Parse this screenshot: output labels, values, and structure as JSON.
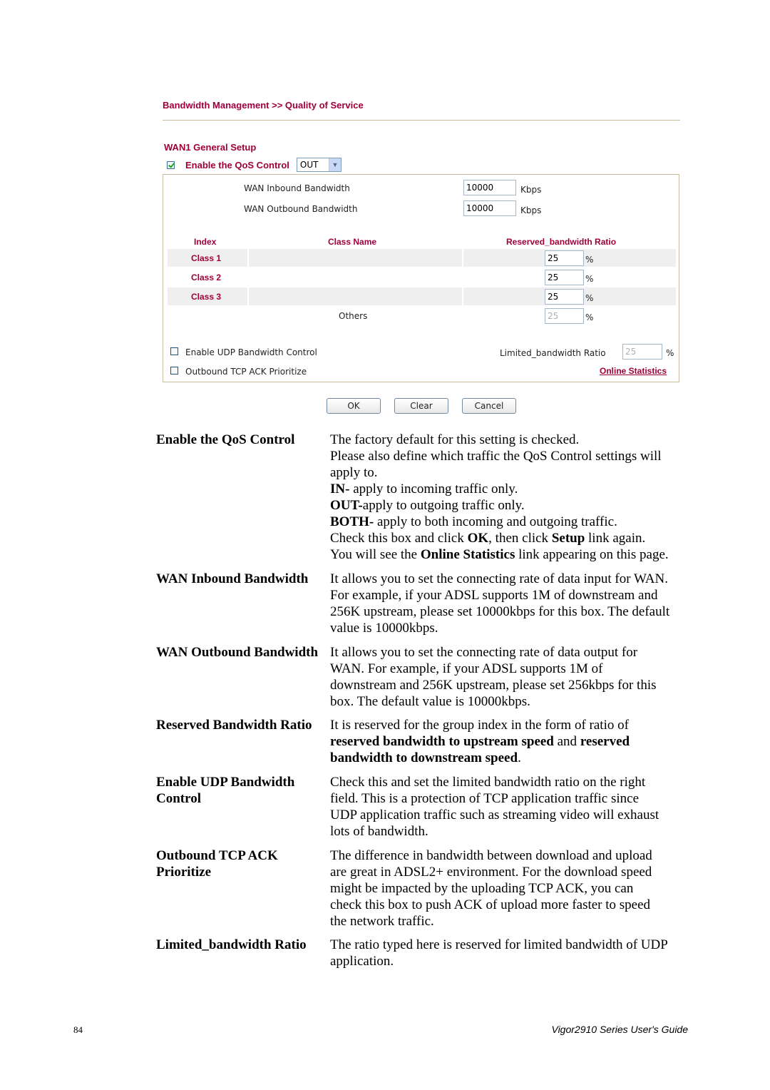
{
  "ui": {
    "breadcrumb": "Bandwidth Management >> Quality of Service",
    "section_title": "WAN1 General Setup",
    "qos_control": {
      "label": "Enable the QoS Control",
      "checked": true,
      "direction_value": "OUT"
    },
    "inbound": {
      "label": "WAN Inbound Bandwidth",
      "value": "10000",
      "unit": "Kbps"
    },
    "outbound": {
      "label": "WAN Outbound Bandwidth",
      "value": "10000",
      "unit": "Kbps"
    },
    "table": {
      "headers": {
        "index": "Index",
        "class_name": "Class Name",
        "ratio": "Reserved_bandwidth Ratio"
      },
      "rows": [
        {
          "index": "Class 1",
          "class_name": "",
          "ratio": "25",
          "unit": "%"
        },
        {
          "index": "Class 2",
          "class_name": "",
          "ratio": "25",
          "unit": "%"
        },
        {
          "index": "Class 3",
          "class_name": "",
          "ratio": "25",
          "unit": "%"
        }
      ],
      "others": {
        "label": "Others",
        "ratio": "25",
        "unit": "%"
      }
    },
    "udp_control": {
      "label": "Enable UDP Bandwidth Control",
      "checked": false
    },
    "tcp_ack": {
      "label": "Outbound TCP ACK Prioritize",
      "checked": false
    },
    "limited_ratio": {
      "label": "Limited_bandwidth Ratio",
      "value": "25",
      "unit": "%"
    },
    "online_statistics_link": "Online Statistics",
    "buttons": {
      "ok": "OK",
      "clear": "Clear",
      "cancel": "Cancel"
    }
  },
  "doc": {
    "entries": [
      {
        "term": "Enable the QoS Control",
        "lines": [
          [
            {
              "t": "The factory default for this setting is checked."
            }
          ],
          [
            {
              "t": "Please also define which traffic the QoS Control settings will"
            }
          ],
          [
            {
              "t": "apply to."
            }
          ],
          [
            {
              "t": "IN-",
              "b": true
            },
            {
              "t": " apply to incoming traffic only."
            }
          ],
          [
            {
              "t": "OUT-",
              "b": true
            },
            {
              "t": "apply to outgoing traffic only."
            }
          ],
          [
            {
              "t": "BOTH-",
              "b": true
            },
            {
              "t": " apply to both incoming and outgoing traffic."
            }
          ],
          [
            {
              "t": "Check this box and click "
            },
            {
              "t": "OK",
              "b": true
            },
            {
              "t": ", then click "
            },
            {
              "t": "Setup",
              "b": true
            },
            {
              "t": " link again."
            }
          ],
          [
            {
              "t": "You will see the "
            },
            {
              "t": "Online Statistics",
              "b": true
            },
            {
              "t": " link appearing on this page."
            }
          ]
        ]
      },
      {
        "term": "WAN Inbound Bandwidth",
        "lines": [
          [
            {
              "t": "It allows you to set the connecting rate of data input for WAN."
            }
          ],
          [
            {
              "t": "For example, if your ADSL supports 1M of downstream and"
            }
          ],
          [
            {
              "t": "256K upstream, please set 10000kbps for this box. The default"
            }
          ],
          [
            {
              "t": "value is 10000kbps."
            }
          ]
        ]
      },
      {
        "term": "WAN Outbound Bandwidth",
        "lines": [
          [
            {
              "t": "It allows you to set the connecting rate of data output for"
            }
          ],
          [
            {
              "t": "WAN. For example, if your ADSL supports 1M of"
            }
          ],
          [
            {
              "t": "downstream and 256K upstream, please set 256kbps for this"
            }
          ],
          [
            {
              "t": "box. The default value is 10000kbps."
            }
          ]
        ]
      },
      {
        "term": "Reserved Bandwidth Ratio",
        "lines": [
          [
            {
              "t": "It is reserved for the group index in the form of ratio of"
            }
          ],
          [
            {
              "t": "reserved bandwidth to upstream speed",
              "b": true
            },
            {
              "t": " and "
            },
            {
              "t": "reserved",
              "b": true
            }
          ],
          [
            {
              "t": "bandwidth to downstream speed",
              "b": true
            },
            {
              "t": "."
            }
          ]
        ]
      },
      {
        "term": "Enable UDP Bandwidth Control",
        "term_lines": [
          "Enable UDP Bandwidth",
          "Control"
        ],
        "lines": [
          [
            {
              "t": "Check this and set the limited bandwidth ratio on the right"
            }
          ],
          [
            {
              "t": "field. This is a protection of TCP application traffic since"
            }
          ],
          [
            {
              "t": "UDP application traffic such as streaming video will exhaust"
            }
          ],
          [
            {
              "t": "lots of bandwidth."
            }
          ]
        ]
      },
      {
        "term": "Outbound TCP ACK Prioritize",
        "term_lines": [
          "Outbound TCP ACK",
          "Prioritize"
        ],
        "lines": [
          [
            {
              "t": "The difference in bandwidth between download and upload"
            }
          ],
          [
            {
              "t": "are great in ADSL2+ environment. For the download speed"
            }
          ],
          [
            {
              "t": "might be impacted by the uploading TCP ACK, you can"
            }
          ],
          [
            {
              "t": "check this box to push ACK of upload more faster to speed"
            }
          ],
          [
            {
              "t": "the network traffic."
            }
          ]
        ]
      },
      {
        "term": "Limited_bandwidth Ratio",
        "lines": [
          [
            {
              "t": "The ratio typed here is reserved for limited bandwidth of UDP"
            }
          ],
          [
            {
              "t": "application."
            }
          ]
        ]
      }
    ]
  },
  "footer": {
    "page_number": "84",
    "title": "Vigor2910 Series User's Guide"
  },
  "colors": {
    "accent": "#a0003a",
    "panel_border": "#c9bfa0",
    "row_shade": "#efefef"
  }
}
